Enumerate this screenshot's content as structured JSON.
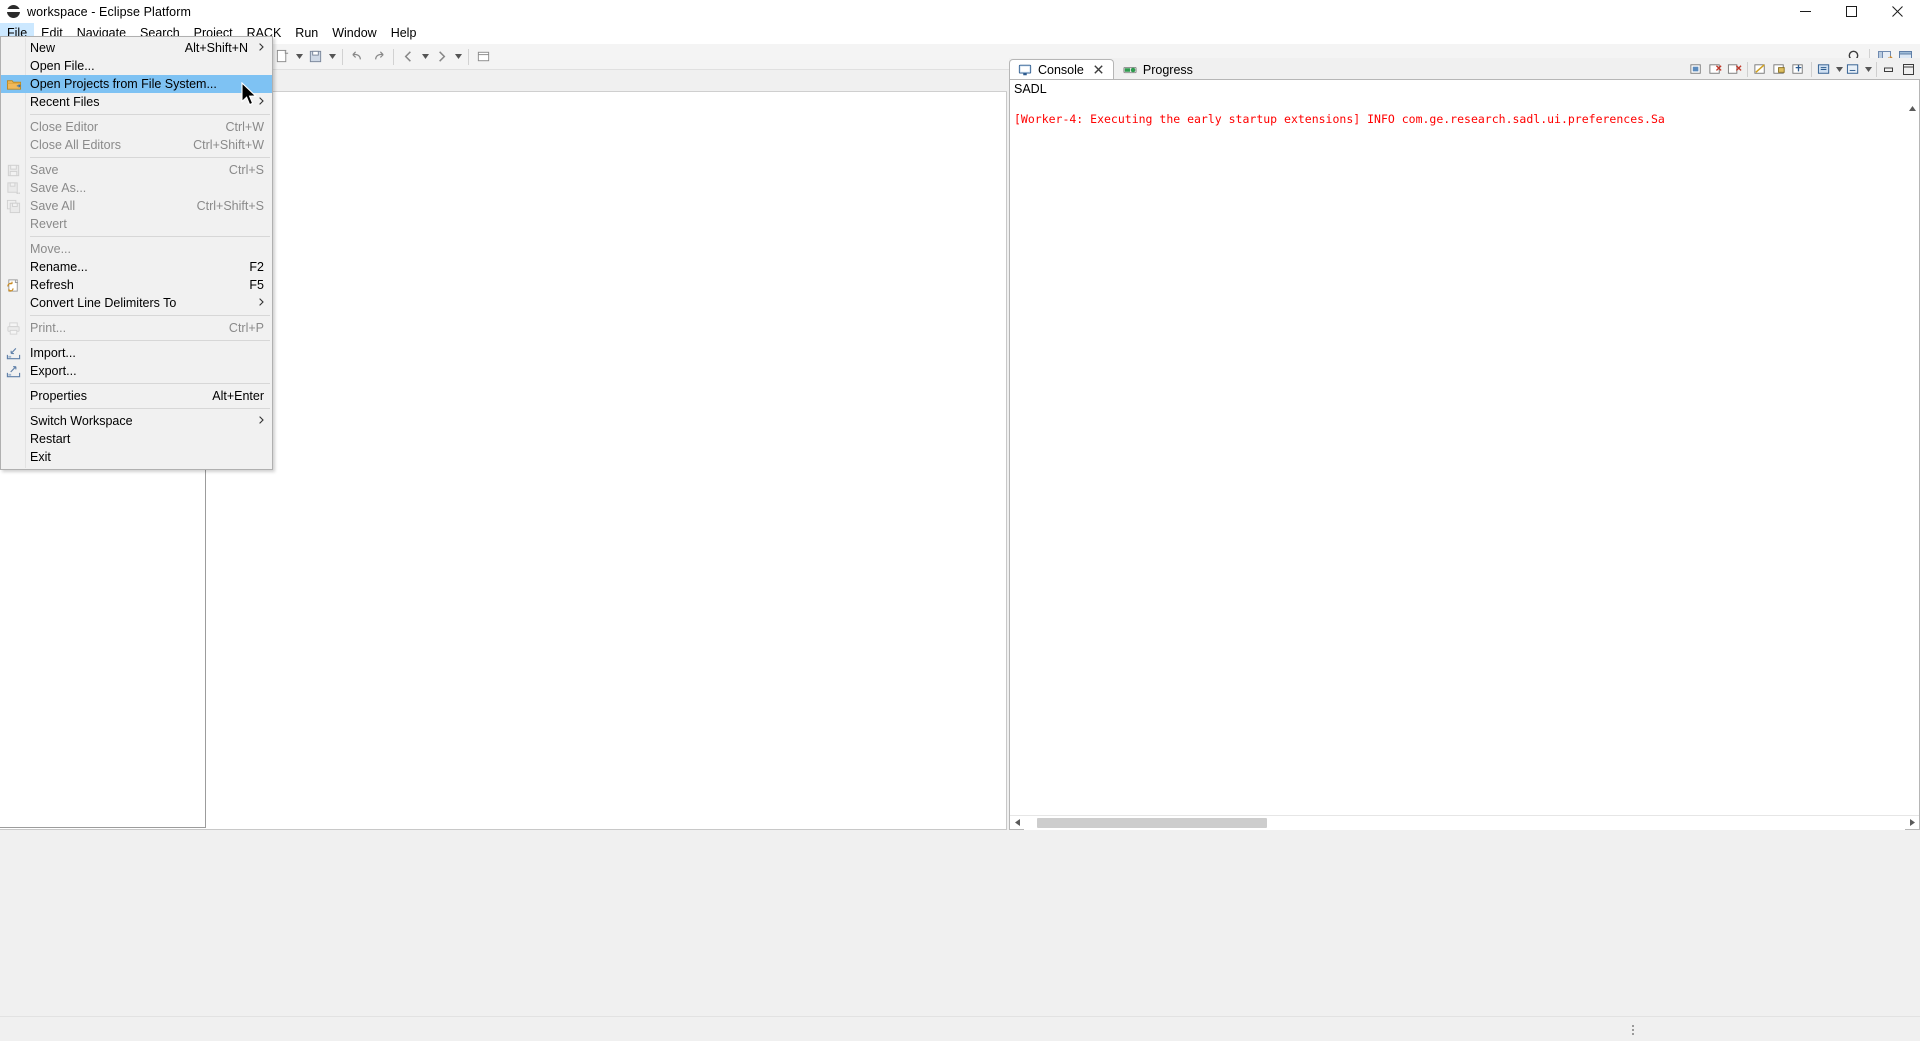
{
  "window": {
    "title": "workspace - Eclipse Platform",
    "icon": "eclipse-globe-icon",
    "controls": {
      "minimize": "minimize-icon",
      "maximize": "maximize-icon",
      "close": "close-icon"
    }
  },
  "menubar": {
    "items": [
      {
        "label": "File",
        "active": true
      },
      {
        "label": "Edit",
        "active": false
      },
      {
        "label": "Navigate",
        "active": false
      },
      {
        "label": "Search",
        "active": false
      },
      {
        "label": "Project",
        "active": false
      },
      {
        "label": "RACK",
        "active": false
      },
      {
        "label": "Run",
        "active": false
      },
      {
        "label": "Window",
        "active": false
      },
      {
        "label": "Help",
        "active": false
      }
    ]
  },
  "file_menu": {
    "items": [
      {
        "label": "New",
        "accel": "Alt+Shift+N",
        "submenu": true,
        "disabled": false,
        "selected": false,
        "icon": ""
      },
      {
        "label": "Open File...",
        "accel": "",
        "submenu": false,
        "disabled": false,
        "selected": false,
        "icon": ""
      },
      {
        "label": "Open Projects from File System...",
        "accel": "",
        "submenu": false,
        "disabled": false,
        "selected": true,
        "icon": "folder-import-icon"
      },
      {
        "label": "Recent Files",
        "accel": "",
        "submenu": true,
        "disabled": false,
        "selected": false,
        "icon": ""
      },
      {
        "separator": true
      },
      {
        "label": "Close Editor",
        "accel": "Ctrl+W",
        "submenu": false,
        "disabled": true,
        "selected": false,
        "icon": ""
      },
      {
        "label": "Close All Editors",
        "accel": "Ctrl+Shift+W",
        "submenu": false,
        "disabled": true,
        "selected": false,
        "icon": ""
      },
      {
        "separator": true
      },
      {
        "label": "Save",
        "accel": "Ctrl+S",
        "submenu": false,
        "disabled": true,
        "selected": false,
        "icon": "save-icon"
      },
      {
        "label": "Save As...",
        "accel": "",
        "submenu": false,
        "disabled": true,
        "selected": false,
        "icon": "save-as-icon"
      },
      {
        "label": "Save All",
        "accel": "Ctrl+Shift+S",
        "submenu": false,
        "disabled": true,
        "selected": false,
        "icon": "save-all-icon"
      },
      {
        "label": "Revert",
        "accel": "",
        "submenu": false,
        "disabled": true,
        "selected": false,
        "icon": ""
      },
      {
        "separator": true
      },
      {
        "label": "Move...",
        "accel": "",
        "submenu": false,
        "disabled": true,
        "selected": false,
        "icon": ""
      },
      {
        "label": "Rename...",
        "accel": "F2",
        "submenu": false,
        "disabled": false,
        "selected": false,
        "icon": ""
      },
      {
        "label": "Refresh",
        "accel": "F5",
        "submenu": false,
        "disabled": false,
        "selected": false,
        "icon": "refresh-icon"
      },
      {
        "label": "Convert Line Delimiters To",
        "accel": "",
        "submenu": true,
        "disabled": false,
        "selected": false,
        "icon": ""
      },
      {
        "separator": true
      },
      {
        "label": "Print...",
        "accel": "Ctrl+P",
        "submenu": false,
        "disabled": true,
        "selected": false,
        "icon": "print-icon"
      },
      {
        "separator": true
      },
      {
        "label": "Import...",
        "accel": "",
        "submenu": false,
        "disabled": false,
        "selected": false,
        "icon": "import-icon"
      },
      {
        "label": "Export...",
        "accel": "",
        "submenu": false,
        "disabled": false,
        "selected": false,
        "icon": "export-icon"
      },
      {
        "separator": true
      },
      {
        "label": "Properties",
        "accel": "Alt+Enter",
        "submenu": false,
        "disabled": false,
        "selected": false,
        "icon": ""
      },
      {
        "separator": true
      },
      {
        "label": "Switch Workspace",
        "accel": "",
        "submenu": true,
        "disabled": false,
        "selected": false,
        "icon": ""
      },
      {
        "label": "Restart",
        "accel": "",
        "submenu": false,
        "disabled": false,
        "selected": false,
        "icon": ""
      },
      {
        "label": "Exit",
        "accel": "",
        "submenu": false,
        "disabled": false,
        "selected": false,
        "icon": ""
      }
    ]
  },
  "toolbar": {
    "left_icons": [
      "new-wizard-icon",
      "new-wizard-dropdown",
      "save-icon",
      "save-dropdown",
      "undo-icon",
      "redo-icon",
      "back-icon",
      "back-dropdown",
      "forward-icon",
      "forward-dropdown",
      "open-resource-icon"
    ],
    "right_icons": [
      "search-icon",
      "perspective-open-icon",
      "perspective-java-icon"
    ]
  },
  "editor_area": {
    "minimize_label": "minimize-icon",
    "maximize_label": "maximize-icon"
  },
  "right_panel": {
    "tabs": [
      {
        "label": "Console",
        "icon": "console-icon",
        "active": true,
        "closable": true
      },
      {
        "label": "Progress",
        "icon": "progress-icon",
        "active": false,
        "closable": false
      }
    ],
    "toolbar_icons": [
      "terminate-icon",
      "remove-launch-icon",
      "remove-all-icon",
      "clear-console-icon",
      "scroll-lock-icon",
      "pin-console-icon",
      "display-console-icon",
      "open-console-icon",
      "minimize-icon",
      "maximize-icon"
    ],
    "console": {
      "name": "SADL",
      "log_line": "[Worker-4: Executing the early startup extensions] INFO com.ge.research.sadl.ui.preferences.Sa",
      "log_color": "#ff0000"
    }
  },
  "statusbar": {
    "grip": "resize-grip"
  }
}
